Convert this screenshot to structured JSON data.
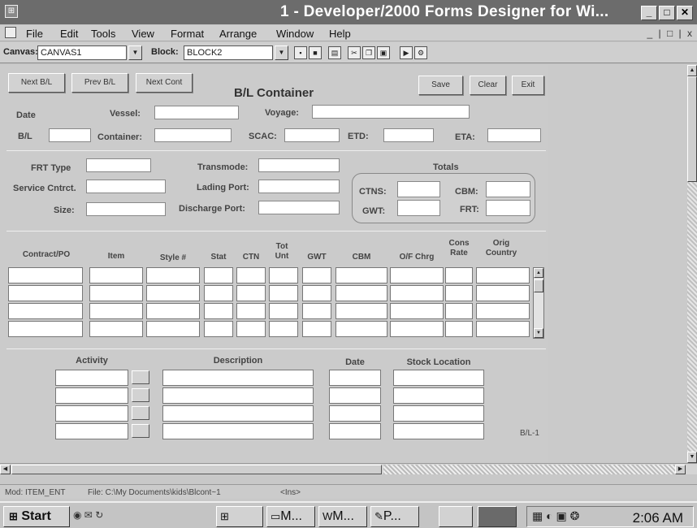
{
  "window": {
    "title": "1 - Developer/2000 Forms Designer for Wi...",
    "icon": "forms-app-icon",
    "controls": [
      "_",
      "□",
      "X"
    ]
  },
  "menubar": {
    "items": [
      "File",
      "Edit",
      "Tools",
      "View",
      "Format",
      "Arrange",
      "Window",
      "Help"
    ],
    "doc_controls": "_ | □ | x"
  },
  "toolbar": {
    "canvas_label": "Canvas:",
    "canvas_value": "CANVAS1",
    "block_label": "Block:",
    "block_value": "BLOCK2",
    "icons": [
      "new-icon",
      "save-icon",
      "print-icon",
      "cut-icon",
      "copy-icon",
      "paste-icon",
      "run-icon",
      "compile-icon"
    ]
  },
  "form": {
    "title": "B/L Container",
    "buttons": {
      "next_bl": "Next B/L",
      "prev_bl": "Prev B/L",
      "next_cont": "Next Cont",
      "save": "Save",
      "clear": "Clear",
      "exit": "Exit"
    },
    "header": {
      "date": "Date",
      "vessel": "Vessel:",
      "voyage": "Voyage:",
      "bl": "B/L",
      "container": "Container:",
      "scac": "SCAC:",
      "etd": "ETD:",
      "eta": "ETA:"
    },
    "details": {
      "frt_type": "FRT Type",
      "service_cntrct": "Service Cntrct.",
      "size": "Size:",
      "transmode": "Transmode:",
      "lading_port": "Lading Port:",
      "discharge_port": "Discharge Port:"
    },
    "totals": {
      "title": "Totals",
      "ctns": "CTNS:",
      "cbm": "CBM:",
      "gwt": "GWT:",
      "frt": "FRT:"
    },
    "grid": {
      "columns": [
        "Contract/PO",
        "Item",
        "Style #",
        "Stat",
        "CTN",
        "Tot Unt",
        "GWT",
        "CBM",
        "O/F Chrg",
        "Cons Rate",
        "Orig Country"
      ],
      "row_count": 4
    },
    "activity": {
      "columns": [
        "Activity",
        "Description",
        "Date",
        "Stock Location"
      ],
      "row_count": 4
    },
    "page_label": "B/L-1"
  },
  "statusbar": {
    "mod": "Mod: ITEM_ENT",
    "file": "File: C:\\My Documents\\kids\\Blcont~1",
    "mode": "<Ins>"
  },
  "taskbar": {
    "start": "Start",
    "tasks": [
      "",
      "M...",
      "M...",
      "P...",
      "",
      ""
    ],
    "clock": "2:06 AM"
  }
}
